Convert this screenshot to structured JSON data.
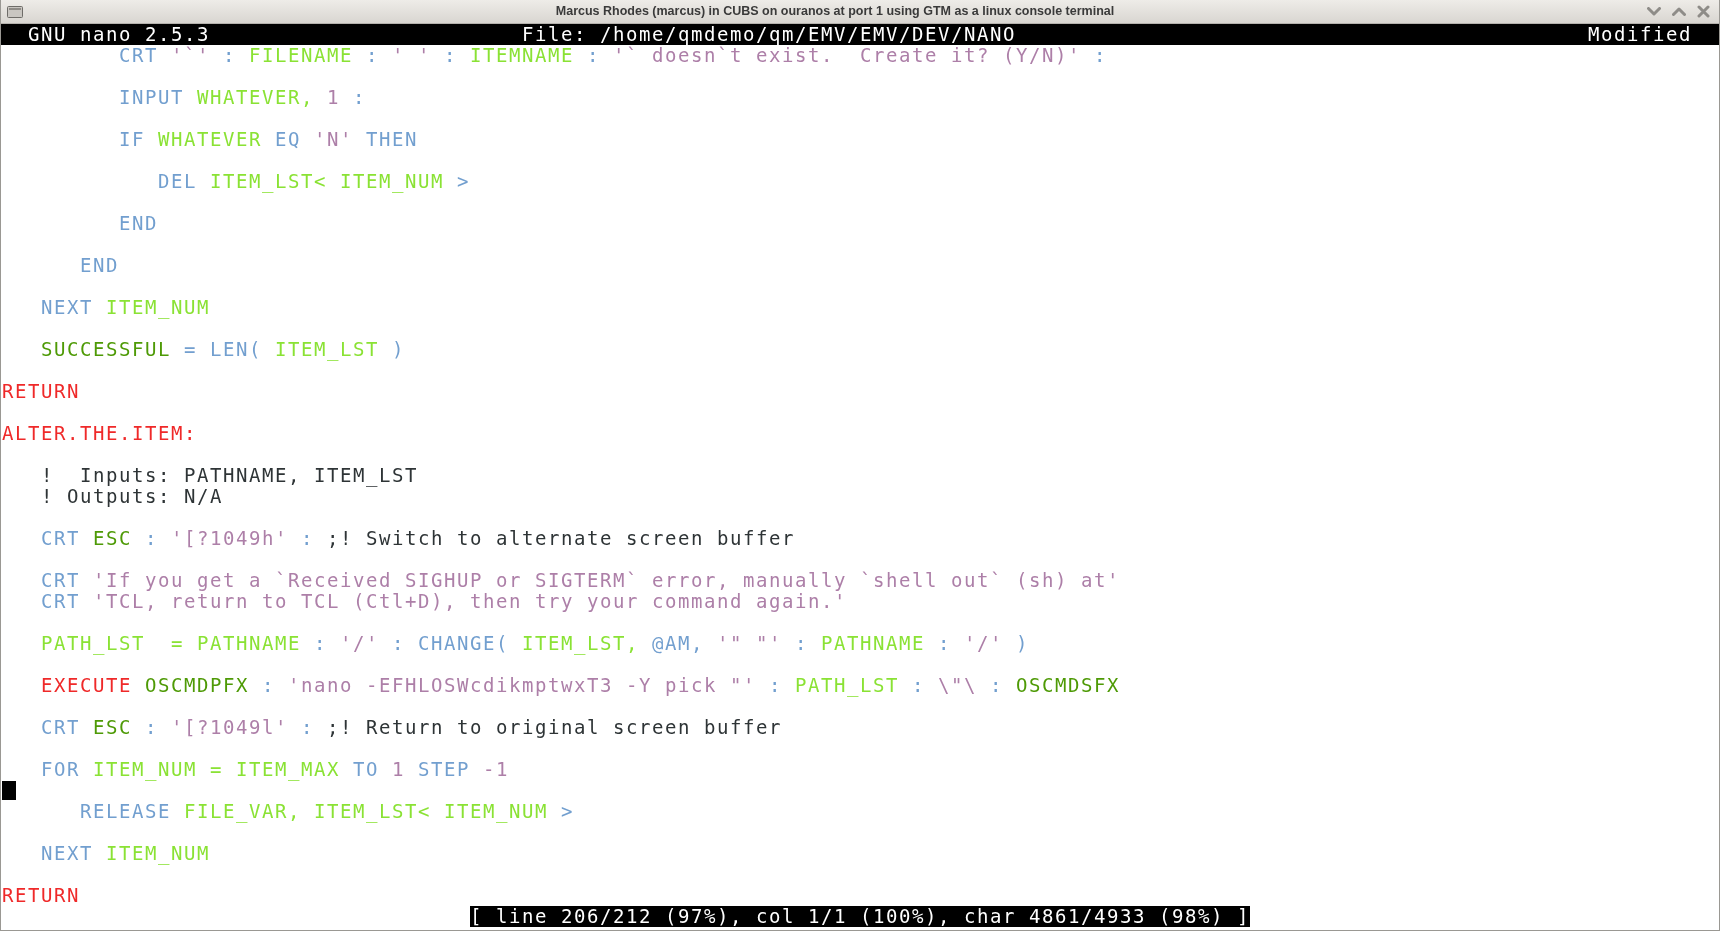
{
  "window": {
    "title": "Marcus Rhodes (marcus) in CUBS on ouranos at port 1 using GTM as a linux console terminal"
  },
  "editor_header": {
    "version": "GNU nano 2.5.3",
    "file": "File: /home/qmdemo/qm/EMV/EMV/DEV/NANO",
    "status": "Modified"
  },
  "editor": {
    "lines": [
      {
        "kind": "code",
        "tokens": [
          {
            "text": "         CRT",
            "kind": "keyword"
          },
          {
            "text": "'`'",
            "kind": "literal"
          },
          {
            "text": ":",
            "kind": "keyword"
          },
          {
            "text": "FILENAME",
            "kind": "variable"
          },
          {
            "text": ":",
            "kind": "keyword"
          },
          {
            "text": "' '",
            "kind": "literal"
          },
          {
            "text": ":",
            "kind": "keyword"
          },
          {
            "text": "ITEMNAME",
            "kind": "variable"
          },
          {
            "text": ":",
            "kind": "keyword"
          },
          {
            "text": "'` doesn`t exist.  Create it? (Y/N)'",
            "kind": "literal"
          },
          {
            "text": ":",
            "kind": "keyword"
          }
        ]
      },
      {
        "kind": "blank"
      },
      {
        "kind": "code",
        "tokens": [
          {
            "text": "         INPUT",
            "kind": "keyword"
          },
          {
            "text": "WHATEVER,",
            "kind": "variable"
          },
          {
            "text": "1",
            "kind": "literal"
          },
          {
            "text": ":",
            "kind": "keyword"
          }
        ]
      },
      {
        "kind": "blank"
      },
      {
        "kind": "code",
        "tokens": [
          {
            "text": "         IF",
            "kind": "keyword"
          },
          {
            "text": "WHATEVER",
            "kind": "variable"
          },
          {
            "text": "EQ",
            "kind": "keyword"
          },
          {
            "text": "'N'",
            "kind": "literal"
          },
          {
            "text": "THEN",
            "kind": "keyword"
          }
        ]
      },
      {
        "kind": "blank"
      },
      {
        "kind": "code",
        "tokens": [
          {
            "text": "            DEL",
            "kind": "keyword"
          },
          {
            "text": "ITEM_LST< ITEM_NUM",
            "kind": "variable"
          },
          {
            "text": ">",
            "kind": "keyword"
          }
        ]
      },
      {
        "kind": "blank"
      },
      {
        "kind": "code",
        "tokens": [
          {
            "text": "         END",
            "kind": "keyword"
          }
        ]
      },
      {
        "kind": "blank"
      },
      {
        "kind": "code",
        "tokens": [
          {
            "text": "      END",
            "kind": "keyword"
          }
        ]
      },
      {
        "kind": "blank"
      },
      {
        "kind": "code",
        "tokens": [
          {
            "text": "   NEXT",
            "kind": "keyword"
          },
          {
            "text": "ITEM_NUM",
            "kind": "variable"
          }
        ]
      },
      {
        "kind": "blank"
      },
      {
        "kind": "code",
        "tokens": [
          {
            "text": "   SUCCESSFUL",
            "kind": "equate"
          },
          {
            "text": "= LEN(",
            "kind": "keyword"
          },
          {
            "text": "ITEM_LST",
            "kind": "variable"
          },
          {
            "text": ")",
            "kind": "keyword"
          }
        ]
      },
      {
        "kind": "blank"
      },
      {
        "kind": "code",
        "tokens": [
          {
            "text": "RETURN",
            "kind": "flow"
          }
        ]
      },
      {
        "kind": "blank"
      },
      {
        "kind": "code",
        "tokens": [
          {
            "text": "ALTER.THE.ITEM:",
            "kind": "flow"
          }
        ]
      },
      {
        "kind": "blank"
      },
      {
        "kind": "code",
        "tokens": [
          {
            "text": "   !  Inputs: PATHNAME, ITEM_LST",
            "kind": "comment"
          }
        ]
      },
      {
        "kind": "code",
        "tokens": [
          {
            "text": "   ! Outputs: N/A",
            "kind": "comment"
          }
        ]
      },
      {
        "kind": "blank"
      },
      {
        "kind": "code",
        "tokens": [
          {
            "text": "   CRT",
            "kind": "keyword"
          },
          {
            "text": "ESC",
            "kind": "equate"
          },
          {
            "text": ":",
            "kind": "keyword"
          },
          {
            "text": "'[?1049h'",
            "kind": "literal"
          },
          {
            "text": ":",
            "kind": "keyword"
          },
          {
            "text": ";! Switch to alternate screen buffer",
            "kind": "comment"
          }
        ]
      },
      {
        "kind": "blank"
      },
      {
        "kind": "code",
        "tokens": [
          {
            "text": "   CRT",
            "kind": "keyword"
          },
          {
            "text": "'If you get a `Received SIGHUP or SIGTERM` error, manually `shell out` (sh) at'",
            "kind": "literal"
          }
        ]
      },
      {
        "kind": "code",
        "tokens": [
          {
            "text": "   CRT",
            "kind": "keyword"
          },
          {
            "text": "'TCL, return to TCL (Ctl+D), then try your command again.'",
            "kind": "literal"
          }
        ]
      },
      {
        "kind": "blank"
      },
      {
        "kind": "code",
        "tokens": [
          {
            "text": "   PATH_LST  = PATHNAME",
            "kind": "variable"
          },
          {
            "text": ":",
            "kind": "keyword"
          },
          {
            "text": "'/'",
            "kind": "literal"
          },
          {
            "text": ": CHANGE(",
            "kind": "keyword"
          },
          {
            "text": "ITEM_LST,",
            "kind": "variable"
          },
          {
            "text": "@AM,",
            "kind": "keyword"
          },
          {
            "text": "'\" \"'",
            "kind": "literal"
          },
          {
            "text": ":",
            "kind": "keyword"
          },
          {
            "text": "PATHNAME",
            "kind": "variable"
          },
          {
            "text": ":",
            "kind": "keyword"
          },
          {
            "text": "'/'",
            "kind": "literal"
          },
          {
            "text": ")",
            "kind": "keyword"
          }
        ]
      },
      {
        "kind": "blank"
      },
      {
        "kind": "code",
        "tokens": [
          {
            "text": "   EXECUTE",
            "kind": "flow"
          },
          {
            "text": "OSCMDPFX",
            "kind": "equate"
          },
          {
            "text": ":",
            "kind": "keyword"
          },
          {
            "text": "'nano -EFHLOSWcdikmptwxT3 -Y pick \"'",
            "kind": "literal"
          },
          {
            "text": ":",
            "kind": "keyword"
          },
          {
            "text": "PATH_LST",
            "kind": "variable"
          },
          {
            "text": ":",
            "kind": "keyword"
          },
          {
            "text": "\\\"\\",
            "kind": "literal"
          },
          {
            "text": ":",
            "kind": "keyword"
          },
          {
            "text": "OSCMDSFX",
            "kind": "equate"
          }
        ]
      },
      {
        "kind": "blank"
      },
      {
        "kind": "code",
        "tokens": [
          {
            "text": "   CRT",
            "kind": "keyword"
          },
          {
            "text": "ESC",
            "kind": "equate"
          },
          {
            "text": ":",
            "kind": "keyword"
          },
          {
            "text": "'[?1049l'",
            "kind": "literal"
          },
          {
            "text": ":",
            "kind": "keyword"
          },
          {
            "text": ";! Return to original screen buffer",
            "kind": "comment"
          }
        ]
      },
      {
        "kind": "blank"
      },
      {
        "kind": "code",
        "tokens": [
          {
            "text": "   FOR",
            "kind": "keyword"
          },
          {
            "text": "ITEM_NUM = ITEM_MAX",
            "kind": "variable"
          },
          {
            "text": "TO",
            "kind": "keyword"
          },
          {
            "text": "1",
            "kind": "literal"
          },
          {
            "text": "STEP",
            "kind": "keyword"
          },
          {
            "text": "-1",
            "kind": "literal"
          }
        ]
      },
      {
        "kind": "cursor"
      },
      {
        "kind": "code",
        "tokens": [
          {
            "text": "      RELEASE",
            "kind": "keyword"
          },
          {
            "text": "FILE_VAR, ITEM_LST< ITEM_NUM",
            "kind": "variable"
          },
          {
            "text": ">",
            "kind": "keyword"
          }
        ]
      },
      {
        "kind": "blank"
      },
      {
        "kind": "code",
        "tokens": [
          {
            "text": "   NEXT",
            "kind": "keyword"
          },
          {
            "text": "ITEM_NUM",
            "kind": "variable"
          }
        ]
      },
      {
        "kind": "blank"
      },
      {
        "kind": "code",
        "tokens": [
          {
            "text": "RETURN",
            "kind": "flow"
          }
        ]
      }
    ]
  },
  "status_bar": {
    "text": "[ line 206/212 (97%), col 1/1 (100%), char 4861/4933 (98%) ]"
  }
}
